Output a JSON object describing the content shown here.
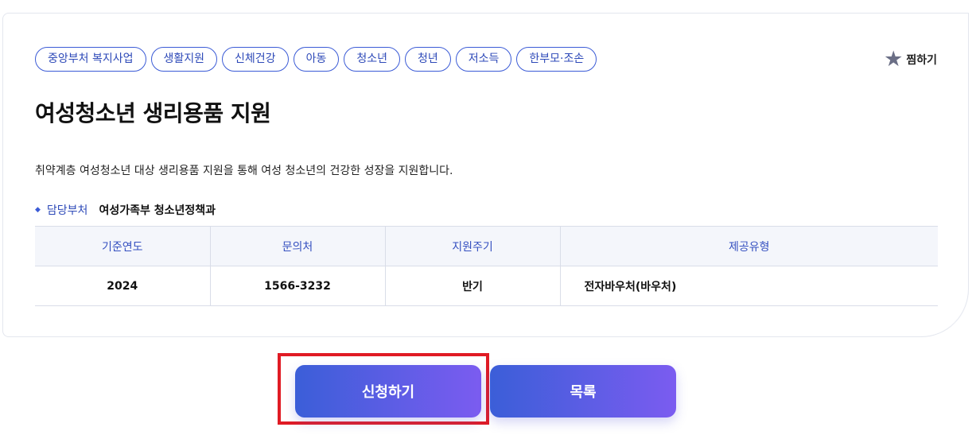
{
  "tags": [
    "중앙부처 복지사업",
    "생활지원",
    "신체건강",
    "아동",
    "청소년",
    "청년",
    "저소득",
    "한부모·조손"
  ],
  "favorite": {
    "icon": "star-icon",
    "label": "찜하기"
  },
  "title": "여성청소년 생리용품 지원",
  "description": "취약계층 여성청소년 대상 생리용품 지원을 통해 여성 청소년의 건강한 성장을 지원합니다.",
  "department": {
    "label": "담당부처",
    "value": "여성가족부 청소년정책과"
  },
  "info_table": {
    "headers": [
      "기준연도",
      "문의처",
      "지원주기",
      "제공유형"
    ],
    "row": [
      "2024",
      "1566-3232",
      "반기",
      "전자바우처(바우처)"
    ]
  },
  "buttons": {
    "apply": "신청하기",
    "list": "목록"
  },
  "colors": {
    "accent": "#3b5bd6",
    "gradient_end": "#7b5cf0",
    "highlight": "#e01b24"
  }
}
